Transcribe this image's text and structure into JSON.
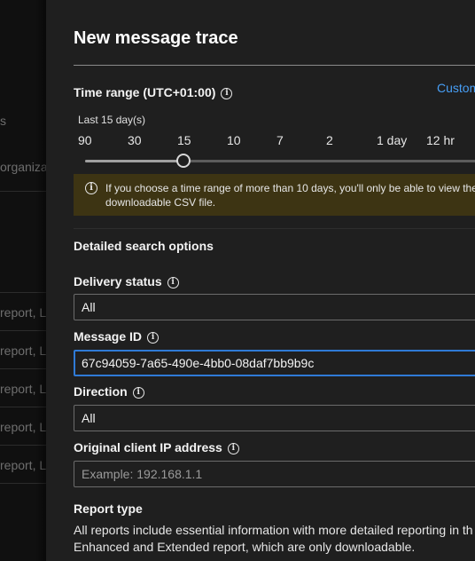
{
  "background": {
    "items": [
      "s",
      "organiza",
      "report, L",
      "report, L",
      "report, L",
      "report, L",
      "report, L"
    ]
  },
  "panel": {
    "title": "New message trace",
    "time_range": {
      "label": "Time range (UTC+01:00)",
      "info_icon": "info-icon",
      "custom_link": "Custom",
      "selected_label": "Last 15 day(s)",
      "ticks": [
        "90",
        "30",
        "15",
        "10",
        "7",
        "2",
        "1 day",
        "12 hr"
      ],
      "selected_value": "15",
      "warning_icon": "info-icon",
      "warning_text": "If you choose a time range of more than 10 days, you'll only be able to view the downloadable CSV file."
    },
    "detailed": {
      "heading": "Detailed search options",
      "delivery_status": {
        "label": "Delivery status",
        "value": "All"
      },
      "message_id": {
        "label": "Message ID",
        "value": "67c94059-7a65-490e-4bb0-08daf7bb9b9c"
      },
      "direction": {
        "label": "Direction",
        "value": "All"
      },
      "client_ip": {
        "label": "Original client IP address",
        "placeholder": "Example: 192.168.1.1"
      },
      "report_type": {
        "label": "Report type",
        "description_line1": "All reports include essential information with more detailed reporting in th",
        "description_line2": "Enhanced and Extended report, which are only downloadable."
      }
    }
  },
  "colors": {
    "panel_bg": "#1f1f1f",
    "link": "#479ef5",
    "warning_bg": "#3d3413",
    "focus_border": "#2f7ad6"
  }
}
